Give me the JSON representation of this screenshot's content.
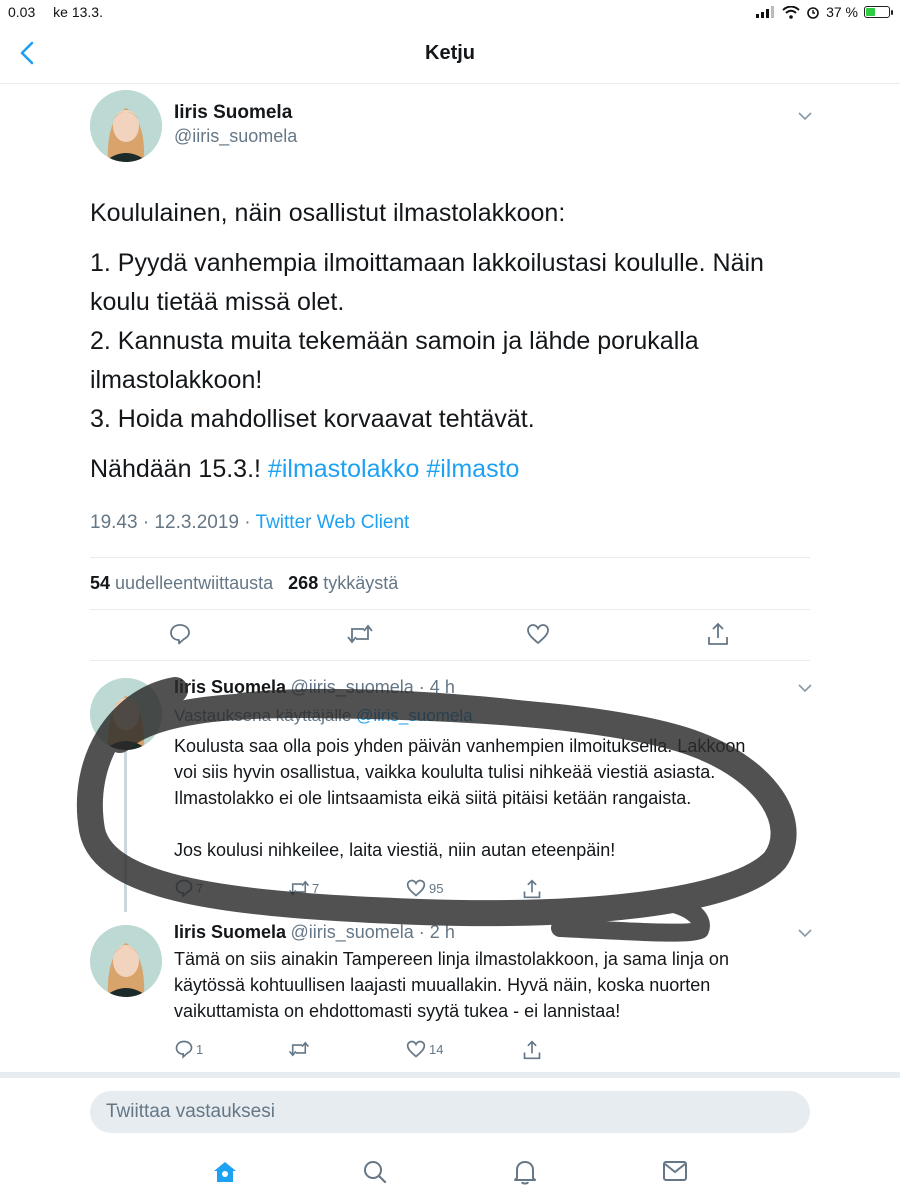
{
  "status_bar": {
    "time": "0.03",
    "date": "ke 13.3.",
    "battery": "37 %",
    "battery_level": 0.37
  },
  "nav": {
    "title": "Ketju"
  },
  "main_tweet": {
    "name": "Iiris Suomela",
    "handle": "@iiris_suomela",
    "intro": "Koululainen, näin osallistut ilmastolakkoon:",
    "lines": [
      "1. Pyydä vanhempia ilmoittamaan lakkoilustasi koululle. Näin koulu tietää missä olet.",
      "2. Kannusta muita tekemään samoin ja lähde porukalla ilmastolakkoon!",
      "3. Hoida mahdolliset korvaavat tehtävät."
    ],
    "closing": "Nähdään 15.3.!",
    "hashtags": "#ilmastolakko #ilmasto",
    "timestamp": "19.43 · 12.3.2019 ·",
    "client": "Twitter Web Client",
    "retweets": "54",
    "retweets_label": "uudelleentwiittausta",
    "likes": "268",
    "likes_label": "tykkäystä"
  },
  "replies": [
    {
      "name": "Iiris Suomela",
      "handle": "@iiris_suomela · 4 h",
      "reply_to_label": "Vastauksena käyttäjälle",
      "reply_to_handle": "@iiris_suomela",
      "text_lines": [
        "Koulusta saa olla pois yhden päivän vanhempien ilmoituksella. Lakkoon",
        "voi siis hyvin osallistua, vaikka koululta tulisi nihkeää viestiä asiasta.",
        "Ilmastolakko ei ole lintsaamista eikä siitä pitäisi ketään rangaista."
      ],
      "text_line_2": "Jos koulusi nihkeilee, laita viestiä, niin autan eteenpäin!",
      "replies": "7",
      "retweets": "7",
      "likes": "95"
    },
    {
      "name": "Iiris Suomela",
      "handle": "@iiris_suomela · 2 h",
      "text_lines": [
        "Tämä on siis ainakin Tampereen linja ilmastolakkoon, ja sama linja on",
        "käytössä kohtuullisen laajasti muuallakin. Hyvä näin, koska nuorten",
        "vaikuttamista on ehdottomasti syytä tukea - ei lannistaa!"
      ],
      "replies": "1",
      "retweets": "",
      "likes": "14"
    }
  ],
  "compose": {
    "placeholder": "Twiittaa vastauksesi"
  },
  "tabbar": {
    "items": [
      "home-icon",
      "search-icon",
      "notifications-icon",
      "messages-icon"
    ]
  },
  "colors": {
    "accent": "#1da1f2",
    "secondary_text": "#657786",
    "divider": "#e6ecf0"
  }
}
